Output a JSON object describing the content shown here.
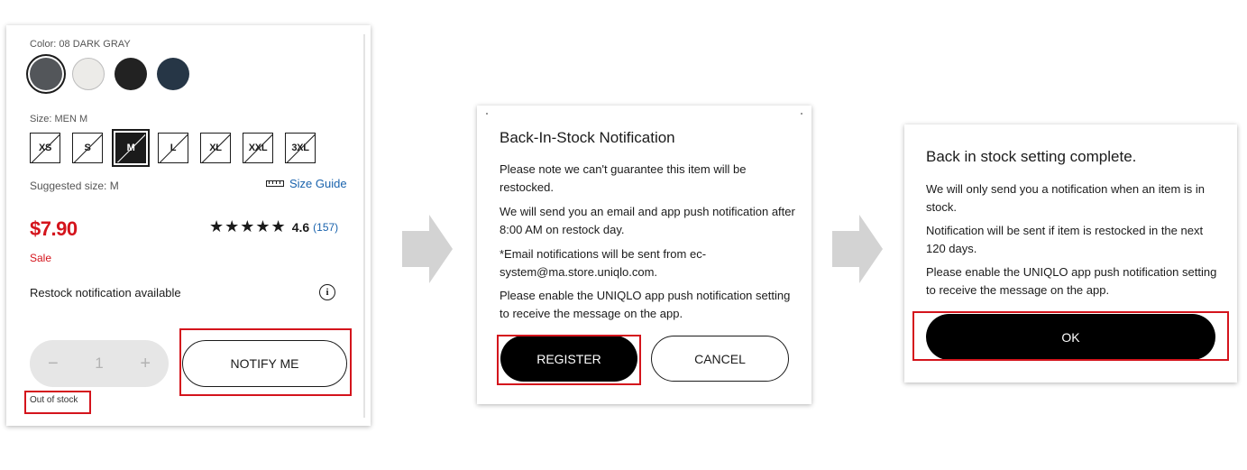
{
  "product": {
    "color_label": "Color: 08 DARK GRAY",
    "swatches": [
      {
        "name": "dark-gray",
        "hex": "#53565a",
        "selected": true
      },
      {
        "name": "off-white",
        "hex": "#ecebe8",
        "selected": false
      },
      {
        "name": "black",
        "hex": "#222222",
        "selected": false
      },
      {
        "name": "navy",
        "hex": "#263646",
        "selected": false
      }
    ],
    "size_label": "Size: MEN M",
    "sizes": [
      {
        "label": "XS",
        "selected": false
      },
      {
        "label": "S",
        "selected": false
      },
      {
        "label": "M",
        "selected": true
      },
      {
        "label": "L",
        "selected": false
      },
      {
        "label": "XL",
        "selected": false
      },
      {
        "label": "XXL",
        "selected": false
      },
      {
        "label": "3XL",
        "selected": false
      }
    ],
    "suggested_size": "Suggested size: M",
    "size_guide_label": "Size Guide",
    "price": "$7.90",
    "sale_label": "Sale",
    "rating_stars": "★★★★★",
    "rating_value": "4.6",
    "review_count": "(157)",
    "restock_text": "Restock notification available",
    "info_glyph": "i",
    "quantity": {
      "minus": "−",
      "value": "1",
      "plus": "+"
    },
    "notify_button": "NOTIFY ME",
    "out_of_stock": "Out of stock"
  },
  "dialog": {
    "title": "Back-In-Stock Notification",
    "paragraphs": [
      "Please note we can't guarantee this item will be restocked.",
      "We will send you an email and app push notification after 8:00 AM on restock day.",
      "*Email notifications will be sent from ec-system@ma.store.uniqlo.com.",
      "Please enable the UNIQLO app push notification setting to receive the message on the app."
    ],
    "register_button": "REGISTER",
    "cancel_button": "CANCEL"
  },
  "complete": {
    "title": "Back in stock setting complete.",
    "paragraphs": [
      "We will only send you a notification when an item is in stock.",
      "Notification will be sent if item is restocked in the next 120 days.",
      "Please enable the UNIQLO app push notification setting to receive the message on the app."
    ],
    "ok_button": "OK"
  },
  "colors": {
    "accent_red": "#d4141c",
    "link_blue": "#1a63ad",
    "arrow_gray": "#d3d3d3"
  }
}
